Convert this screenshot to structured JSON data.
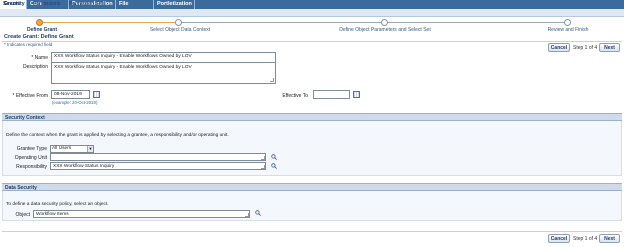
{
  "top_tabs": [
    {
      "label": "Security",
      "active": false
    },
    {
      "label": "Core Services",
      "active": false
    },
    {
      "label": "Personalization",
      "active": false
    },
    {
      "label": "File Manager",
      "active": false
    },
    {
      "label": "Portletization",
      "active": false
    }
  ],
  "sub_tabs": [
    {
      "label": "Grants",
      "active": true
    },
    {
      "label": "Permissions",
      "active": false
    },
    {
      "label": "Permission Sets",
      "active": false
    }
  ],
  "train": {
    "steps": [
      {
        "label": "Define Grant",
        "active": true
      },
      {
        "label": "Select Object Data Context",
        "active": false
      },
      {
        "label": "Define Object Parameters and Select Set",
        "active": false
      },
      {
        "label": "Review and Finish",
        "active": false
      }
    ]
  },
  "page": {
    "title": "Create Grant: Define Grant",
    "required_note": "* Indicates required field",
    "cancel_label": "Cancel",
    "step_text": "Step 1 of 4",
    "next_label": "Next"
  },
  "form": {
    "name_label": "* Name",
    "name_value": "XXX Workflow Status Inquiry - Enable Workflows Owned by LOV",
    "description_label": "Description",
    "description_value": "XXX Workflow Status Inquiry - Enable Workflows Owned by LOV",
    "effective_from_label": "* Effective From",
    "effective_from_value": "08-Nov-2019",
    "effective_from_hint": "(example: 20-Oct-2019)",
    "effective_to_label": "Effective To",
    "effective_to_value": ""
  },
  "security_context": {
    "title": "Security Context",
    "description": "Define the context when the grant is applied by selecting a grantee, a responsibility and/or operating unit.",
    "grantee_type_label": "Grantee Type",
    "grantee_type_value": "All Users",
    "operating_unit_label": "Operating Unit",
    "operating_unit_value": "",
    "responsibility_label": "Responsibility",
    "responsibility_value": "XXX Workflow Status Inquiry"
  },
  "data_security": {
    "title": "Data Security",
    "description": "To define a data security policy, select an object.",
    "object_label": "Object",
    "object_value": "Workflow Items"
  },
  "colors": {
    "tab_bar": "#3b6b9c",
    "section_header": "#cfdbea",
    "train_active": "#f2a23a",
    "link_text": "#1f3f6c"
  }
}
